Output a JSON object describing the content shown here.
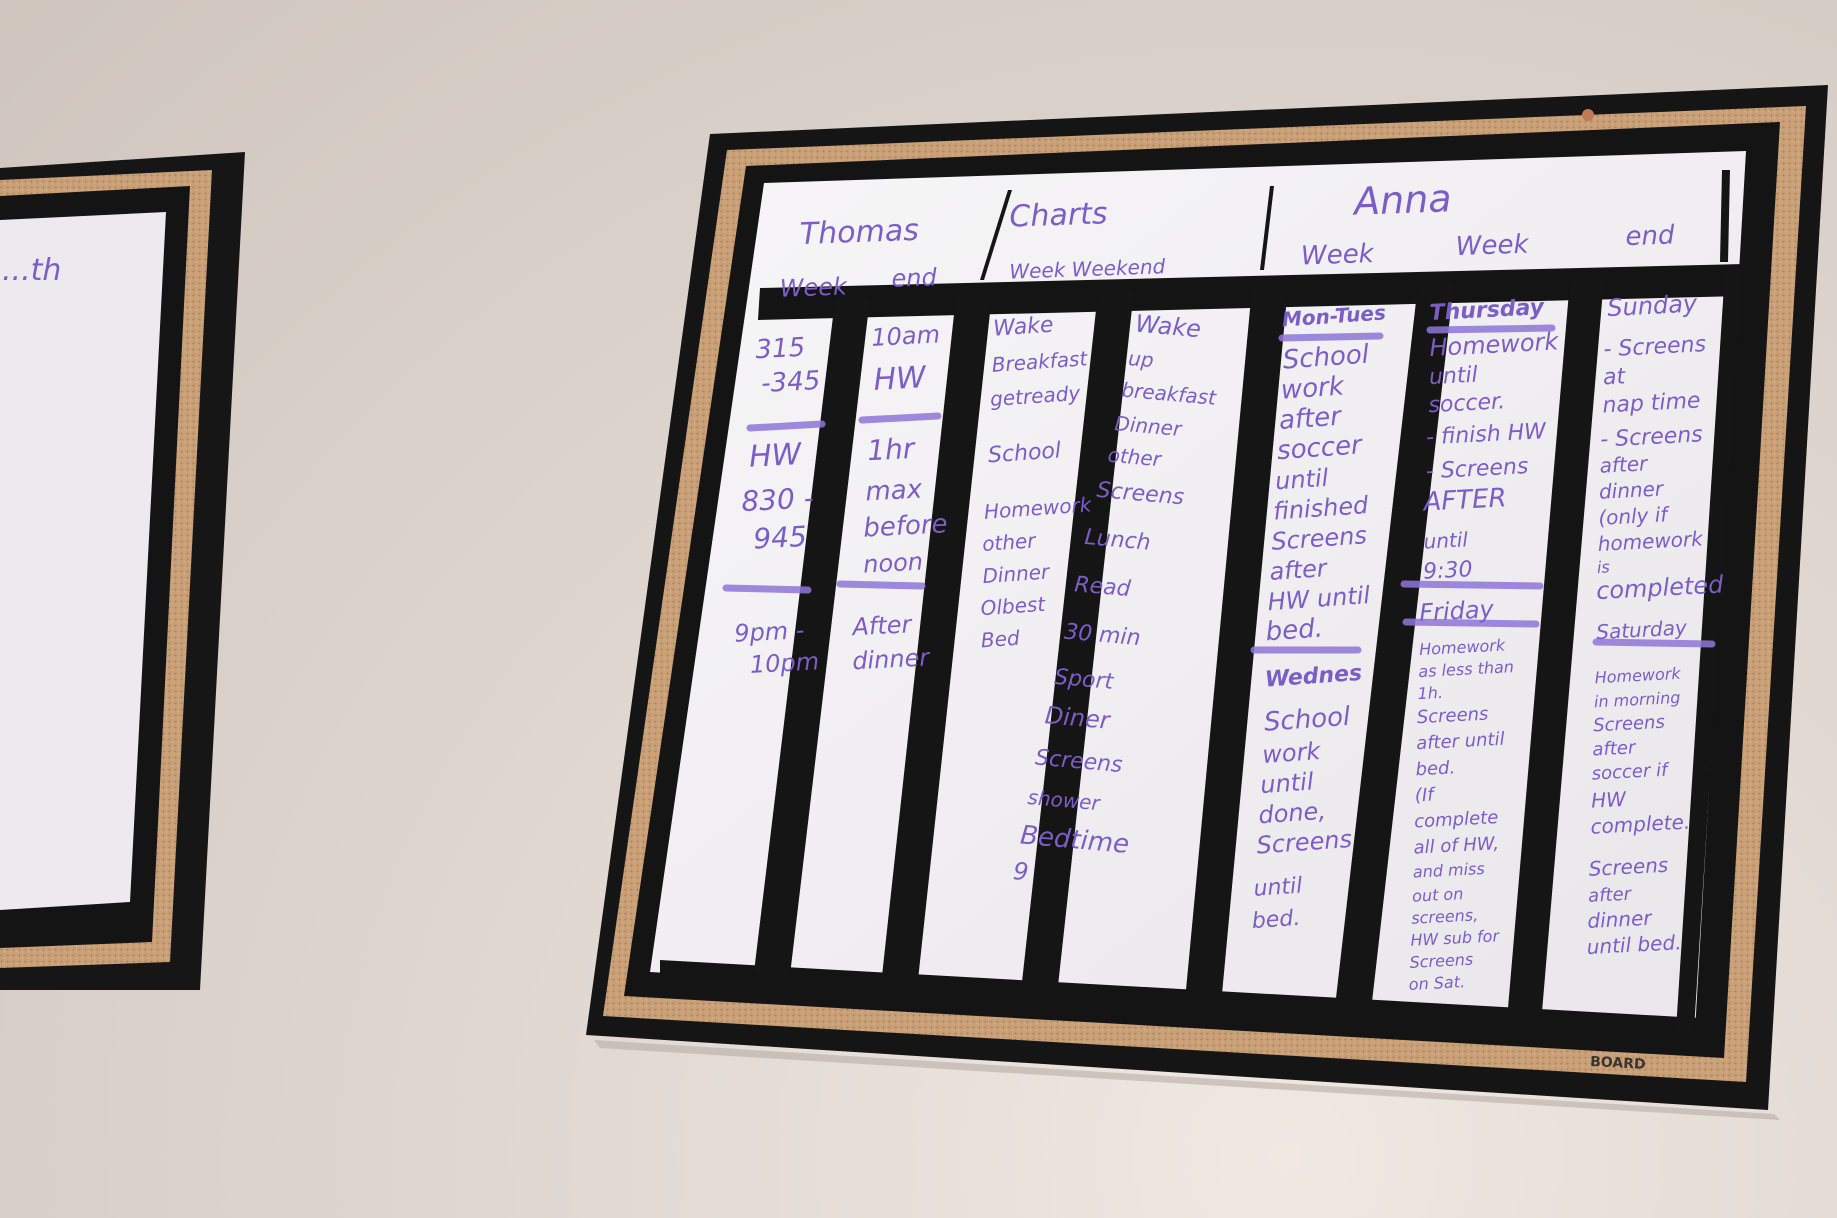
{
  "header": {
    "thomas_name": "Thomas",
    "charts_title": "Charts",
    "anna_name": "Anna",
    "thomas_sub": [
      "Week",
      "end"
    ],
    "middle_sub": "Week  Weekend",
    "anna_sub": [
      "Week",
      "Week",
      "end"
    ]
  },
  "columns": [
    {
      "lines": [
        "315",
        "-345",
        "HW",
        "830 -",
        "945",
        "9pm -",
        "10pm"
      ]
    },
    {
      "lines": [
        "10am",
        "HW",
        "1hr",
        "max",
        "before",
        "noon",
        "After",
        "dinner"
      ]
    },
    {
      "lines": [
        "Wake",
        "Breakfast",
        "getready",
        "School",
        "Homework",
        "other",
        "Dinner",
        "Olbest",
        "Bed"
      ]
    },
    {
      "lines": [
        "Wake",
        "up",
        "breakfast",
        "Dinner",
        "other",
        "Screens",
        "Lunch",
        "Read",
        "30 min",
        "Sport",
        "Diner",
        "Screens",
        "shower",
        "Bedtime",
        "9"
      ]
    },
    {
      "lines": [
        "Mon-Tues",
        "School",
        "work",
        "after",
        "soccer",
        "until",
        "finished",
        "Screens",
        "after",
        "HW until",
        "bed.",
        "Wednes",
        "School",
        "work",
        "until",
        "done,",
        "Screens",
        "until",
        "bed."
      ]
    },
    {
      "lines": [
        "Thursday",
        "Homework",
        "until",
        "soccer.",
        "- finish HW",
        "- Screens",
        "AFTER",
        "until",
        "9:30",
        "Friday",
        "Homework",
        "as less than",
        "1h.",
        "Screens",
        "after until",
        "bed.",
        "(If",
        "complete",
        "all of HW,",
        "and miss",
        "out on",
        "screens,",
        "HW sub for",
        "Screens",
        "on Sat."
      ]
    },
    {
      "lines": [
        "Sunday",
        "- Screens",
        "at",
        "nap time",
        "- Screens",
        "after",
        "dinner",
        "(only if",
        "homework",
        "is",
        "completed",
        "Saturday",
        "Homework",
        "in morning",
        "Screens",
        "after",
        "soccer if",
        "HW",
        "complete.",
        "Screens",
        "after",
        "dinner",
        "until bed."
      ]
    }
  ],
  "brand": "BOARD",
  "left_board": {
    "text": "...th"
  }
}
